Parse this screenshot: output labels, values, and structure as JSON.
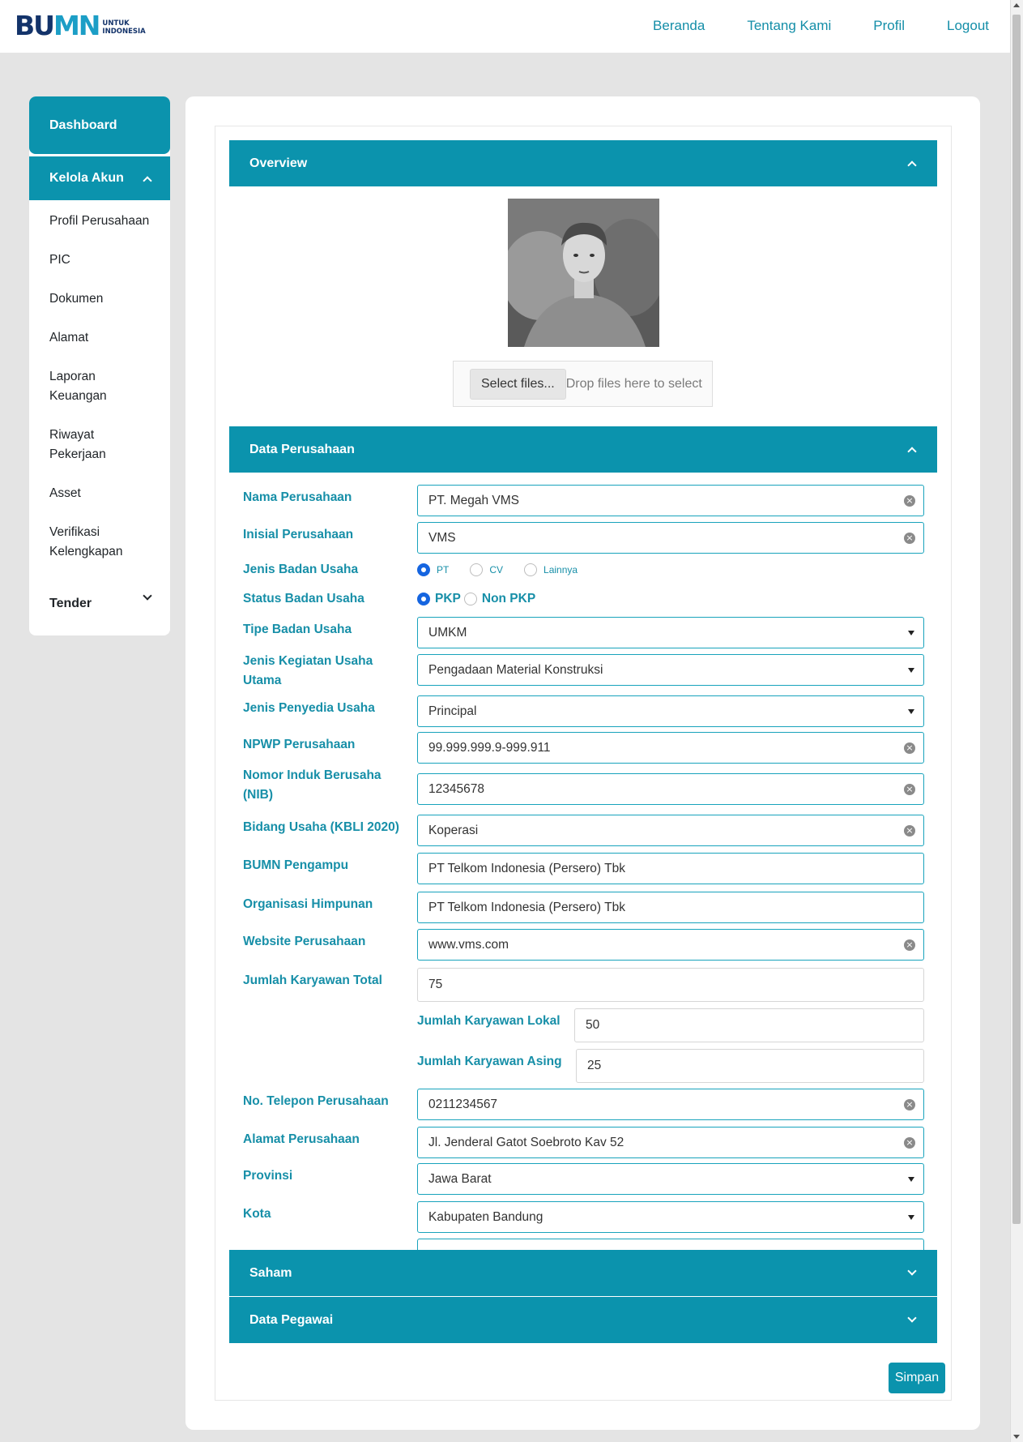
{
  "header": {
    "logo_main": "BUMN",
    "logo_sub_1": "UNTUK",
    "logo_sub_2": "INDONESIA",
    "nav": [
      "Beranda",
      "Tentang Kami",
      "Profil",
      "Logout"
    ]
  },
  "sidebar": {
    "dashboard": "Dashboard",
    "kelola_akun": "Kelola Akun",
    "items": [
      "Profil Perusahaan",
      "PIC",
      "Dokumen",
      "Alamat",
      "Laporan Keuangan",
      "Riwayat Pekerjaan",
      "Asset",
      "Verifikasi Kelengkapan"
    ],
    "tender": "Tender"
  },
  "sections": {
    "overview": "Overview",
    "data_perusahaan": "Data Perusahaan",
    "saham": "Saham",
    "data_pegawai": "Data Pegawai"
  },
  "upload": {
    "button": "Select files...",
    "hint": "Drop files here to select"
  },
  "form": {
    "nama_perusahaan": {
      "label": "Nama Perusahaan",
      "value": "PT. Megah VMS"
    },
    "inisial": {
      "label": "Inisial Perusahaan",
      "value": "VMS"
    },
    "jenis_badan": {
      "label": "Jenis Badan Usaha",
      "options": [
        "PT",
        "CV",
        "Lainnya"
      ],
      "selected": "PT"
    },
    "status_badan": {
      "label": "Status Badan Usaha",
      "options": [
        "PKP",
        "Non PKP"
      ],
      "selected": "PKP"
    },
    "tipe_badan": {
      "label": "Tipe Badan Usaha",
      "value": "UMKM"
    },
    "jenis_kegiatan": {
      "label": "Jenis Kegiatan Usaha Utama",
      "value": "Pengadaan Material Konstruksi"
    },
    "jenis_penyedia": {
      "label": "Jenis Penyedia Usaha",
      "value": "Principal"
    },
    "npwp": {
      "label": "NPWP Perusahaan",
      "value": "99.999.999.9-999.911"
    },
    "nib": {
      "label": "Nomor Induk Berusaha (NIB)",
      "value": "12345678"
    },
    "bidang_usaha": {
      "label": "Bidang Usaha (KBLI 2020)",
      "value": "Koperasi"
    },
    "bumn_pengampu": {
      "label": "BUMN Pengampu",
      "value": "PT Telkom Indonesia (Persero) Tbk"
    },
    "organisasi": {
      "label": "Organisasi Himpunan",
      "value": "PT Telkom Indonesia (Persero) Tbk"
    },
    "website": {
      "label": "Website Perusahaan",
      "value": "www.vms.com"
    },
    "karyawan_total": {
      "label": "Jumlah Karyawan Total",
      "value": "75"
    },
    "karyawan_lokal": {
      "label": "Jumlah Karyawan Lokal",
      "value": "50"
    },
    "karyawan_asing": {
      "label": "Jumlah Karyawan Asing",
      "value": "25"
    },
    "telepon": {
      "label": "No. Telepon Perusahaan",
      "value": "0211234567"
    },
    "alamat": {
      "label": "Alamat Perusahaan",
      "value": "Jl. Jenderal Gatot Soebroto Kav 52"
    },
    "provinsi": {
      "label": "Provinsi",
      "value": "Jawa Barat"
    },
    "kota": {
      "label": "Kota",
      "value": "Kabupaten Bandung"
    }
  },
  "actions": {
    "save": "Simpan"
  },
  "colors": {
    "accent": "#0b93ad",
    "label": "#178fa8",
    "radio": "#1565e0"
  }
}
